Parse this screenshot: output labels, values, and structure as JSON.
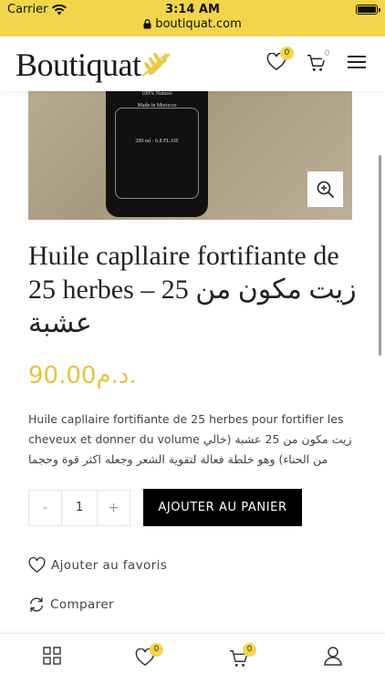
{
  "status": {
    "carrier": "Carrier",
    "time": "3:14 AM",
    "url": "boutiquat.com"
  },
  "header": {
    "logo_text": "Boutiquat",
    "wishlist_count": "0",
    "cart_count": "0"
  },
  "product": {
    "image_label_1": "100% Naturel",
    "image_label_2": "Made in Morocco",
    "image_label_3": "200 ml · 6.8 FL.OZ",
    "title": "Huile capllaire fortifiante de 25 herbes – زيت مكون من 25 عشبة",
    "price": "90.00د.م.",
    "description": "Huile capllaire fortifiante de 25 herbes pour fortifier les cheveux et donner du volume زيت مكون من 25 عشبة (خالي من الحناء) وهو خلطة فعالة لتقوية الشعر وجعله اكثر قوة وحجما",
    "quantity": "1",
    "minus": "-",
    "plus": "+",
    "add_to_cart": "AJOUTER AU PANIER",
    "add_to_wishlist": "Ajouter au favoris",
    "compare": "Comparer"
  },
  "tabbar": {
    "wishlist_count": "0",
    "cart_count": "0"
  },
  "colors": {
    "accent": "#f3d54b",
    "price": "#e5c33c",
    "button": "#000000"
  },
  "icons": [
    "wifi-icon",
    "lock-icon",
    "battery-icon",
    "wheat-leaf-icon",
    "heart-icon",
    "cart-icon",
    "menu-icon",
    "zoom-icon",
    "refresh-icon",
    "grid-icon",
    "user-icon"
  ]
}
